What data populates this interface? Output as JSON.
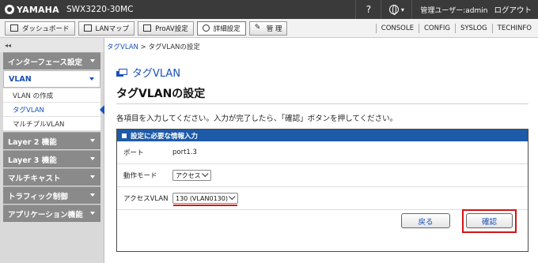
{
  "header": {
    "brand": "YAMAHA",
    "model": "SWX3220-30MC",
    "help": "?",
    "user": "管理ユーザー:admin",
    "logout": "ログアウト"
  },
  "tabs": [
    {
      "label": "ダッシュボード",
      "icon": "dashboard-icon"
    },
    {
      "label": "LANマップ",
      "icon": "lan-map-icon"
    },
    {
      "label": "ProAV設定",
      "icon": "proav-icon"
    },
    {
      "label": "詳細設定",
      "icon": "gear-icon"
    },
    {
      "label": "管 理",
      "icon": "wrench-icon"
    }
  ],
  "right_links": [
    "CONSOLE",
    "CONFIG",
    "SYSLOG",
    "TECHINFO"
  ],
  "sidebar": {
    "collapse": "◂◂",
    "items": [
      {
        "label": "インターフェース設定"
      },
      {
        "label": "VLAN",
        "sub": [
          "VLAN の作成",
          "タグVLAN",
          "マルチプルVLAN"
        ]
      },
      {
        "label": "Layer 2 機能"
      },
      {
        "label": "Layer 3 機能"
      },
      {
        "label": "マルチキャスト"
      },
      {
        "label": "トラフィック制御"
      },
      {
        "label": "アプリケーション機能"
      }
    ]
  },
  "breadcrumb": {
    "link": "タグVLAN",
    "sep": " > ",
    "current": "タグVLANの設定"
  },
  "page": {
    "section": "タグVLAN",
    "title": "タグVLANの設定",
    "instruction": "各項目を入力してください。入力が完了したら、「確認」ボタンを押してください。"
  },
  "form": {
    "heading": "設定に必要な情報入力",
    "port_label": "ポート",
    "port_value": "port1.3",
    "mode_label": "動作モード",
    "mode_value": "アクセス",
    "vlan_label": "アクセスVLAN",
    "vlan_value": "130 (VLAN0130)"
  },
  "buttons": {
    "back": "戻る",
    "confirm": "確認"
  },
  "colors": {
    "accent": "#1a50b8",
    "header": "#3a3a3a",
    "panel_head": "#1f5aa8",
    "highlight": "#d41414"
  }
}
